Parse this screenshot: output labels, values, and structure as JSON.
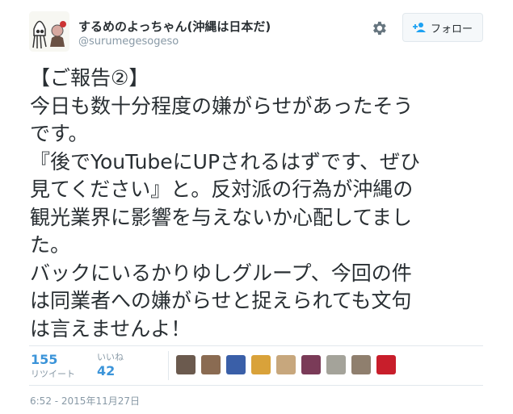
{
  "author": {
    "name": "するめのよっちゃん(沖縄は日本だ)",
    "handle": "@surumegesogeso"
  },
  "follow_button": {
    "label": "フォロー"
  },
  "tweet": {
    "text": "【ご報告②】\n今日も数十分程度の嫌がらせがあったそう\nです。\n『後でYouTubeにUPされるはずです、ぜひ\n見てください』と。反対派の行為が沖縄の\n観光業界に影響を与えないか心配してまし\nた。\nバックにいるかりゆしグループ、今回の件\nは同業者への嫌がらせと捉えられても文句\nは言えませんよ！"
  },
  "stats": {
    "retweets": {
      "label": "リツイート",
      "count": "155"
    },
    "likes": {
      "label": "いいね",
      "count": "42"
    }
  },
  "likers": [
    "#6b5a4e",
    "#8a6b52",
    "#3a5fa8",
    "#d9a23a",
    "#c7a77d",
    "#7a3b58",
    "#a4a39a",
    "#8f7f6e",
    "#c81e2b"
  ],
  "timestamp": "6:52 - 2015年11月27日"
}
